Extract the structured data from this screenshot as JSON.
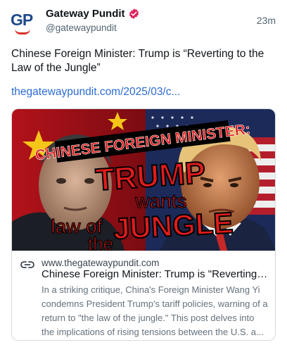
{
  "author": {
    "name": "Gateway Pundit",
    "handle": "@gatewaypundit",
    "avatar_text": "GP",
    "verified_color": "#e0245e"
  },
  "timestamp": "23m",
  "post": {
    "text": "Chinese Foreign Minister: Trump is “Reverting to the Law of the Jungle”",
    "link": "thegatewaypundit.com/2025/03/c..."
  },
  "card": {
    "image": {
      "banner": "CHINESE FOREIGN MINISTER:",
      "line1": "TRUMP",
      "line2": "wants",
      "line3a": "law of",
      "line3b": "the",
      "line4": "JUNGLE"
    },
    "domain": "www.thegatewaypundit.com",
    "title": "Chinese Foreign Minister: Trump is \"Reverting ...",
    "description": "In a striking critique, China's Foreign Minister Wang Yi condemns President Trump's tariff policies, warning of a return to \"the law of the jungle.\" This post delves into the implications of rising tensions between the U.S. a..."
  },
  "colors": {
    "link": "#2b6bd3",
    "brand_blue": "#1f4a8c",
    "brand_red": "#d9302b",
    "headline_red": "#e11b1b"
  },
  "icons": [
    "verified-badge-icon",
    "link-icon"
  ]
}
